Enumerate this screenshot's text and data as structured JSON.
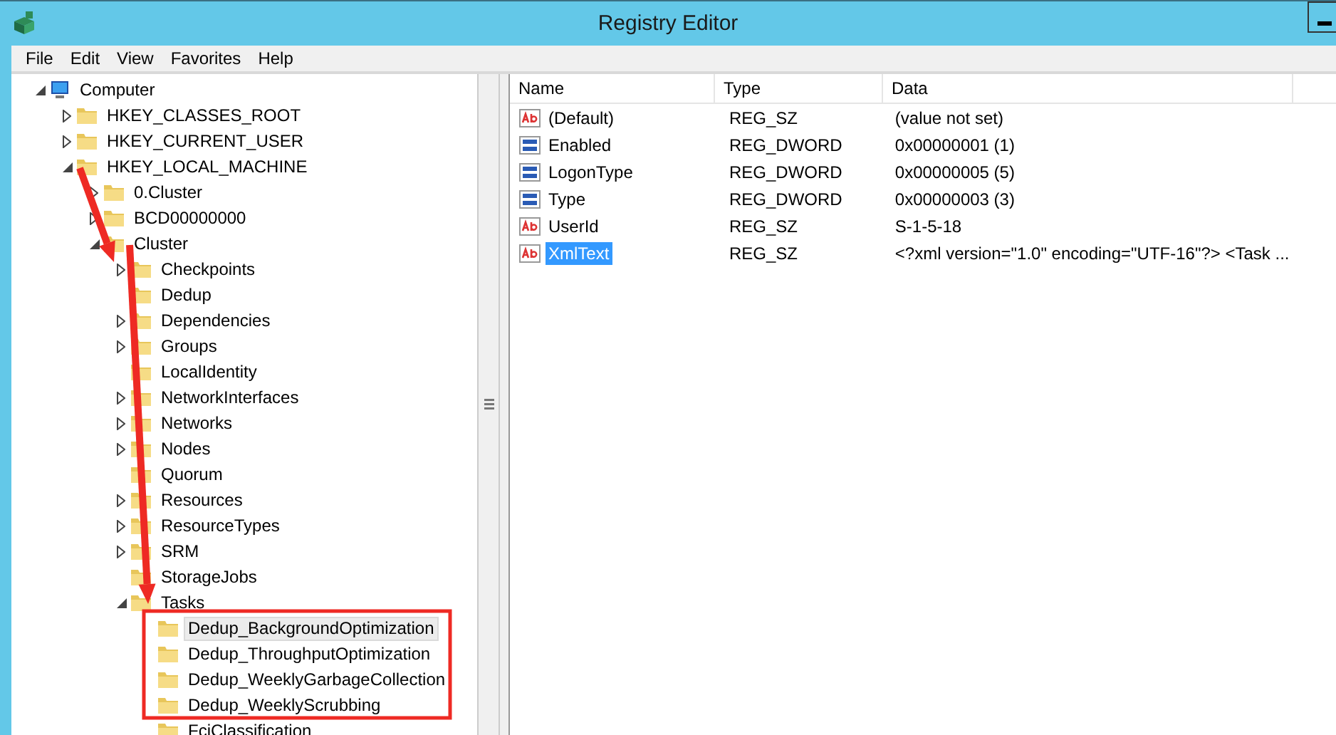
{
  "window": {
    "title": "Registry Editor"
  },
  "menu": [
    "File",
    "Edit",
    "View",
    "Favorites",
    "Help"
  ],
  "tree": [
    {
      "label": "Computer",
      "kind": "computer",
      "expanded": true,
      "selected": false,
      "children": [
        {
          "label": "HKEY_CLASSES_ROOT",
          "kind": "folder",
          "expanded": false,
          "selected": false
        },
        {
          "label": "HKEY_CURRENT_USER",
          "kind": "folder",
          "expanded": false,
          "selected": false
        },
        {
          "label": "HKEY_LOCAL_MACHINE",
          "kind": "folder",
          "expanded": true,
          "selected": false,
          "children": [
            {
              "label": "0.Cluster",
              "kind": "folder",
              "expanded": false,
              "selected": false
            },
            {
              "label": "BCD00000000",
              "kind": "folder",
              "expanded": false,
              "selected": false
            },
            {
              "label": "Cluster",
              "kind": "folder",
              "expanded": true,
              "selected": false,
              "children": [
                {
                  "label": "Checkpoints",
                  "kind": "folder",
                  "expanded": false,
                  "selected": false
                },
                {
                  "label": "Dedup",
                  "kind": "folder",
                  "selected": false
                },
                {
                  "label": "Dependencies",
                  "kind": "folder",
                  "expanded": false,
                  "selected": false
                },
                {
                  "label": "Groups",
                  "kind": "folder",
                  "expanded": false,
                  "selected": false
                },
                {
                  "label": "LocalIdentity",
                  "kind": "folder",
                  "selected": false
                },
                {
                  "label": "NetworkInterfaces",
                  "kind": "folder",
                  "expanded": false,
                  "selected": false
                },
                {
                  "label": "Networks",
                  "kind": "folder",
                  "expanded": false,
                  "selected": false
                },
                {
                  "label": "Nodes",
                  "kind": "folder",
                  "expanded": false,
                  "selected": false
                },
                {
                  "label": "Quorum",
                  "kind": "folder",
                  "selected": false
                },
                {
                  "label": "Resources",
                  "kind": "folder",
                  "expanded": false,
                  "selected": false
                },
                {
                  "label": "ResourceTypes",
                  "kind": "folder",
                  "expanded": false,
                  "selected": false
                },
                {
                  "label": "SRM",
                  "kind": "folder",
                  "expanded": false,
                  "selected": false
                },
                {
                  "label": "StorageJobs",
                  "kind": "folder",
                  "selected": false
                },
                {
                  "label": "Tasks",
                  "kind": "folder",
                  "expanded": true,
                  "selected": false,
                  "children": [
                    {
                      "label": "Dedup_BackgroundOptimization",
                      "kind": "folder",
                      "selected": true
                    },
                    {
                      "label": "Dedup_ThroughputOptimization",
                      "kind": "folder",
                      "selected": false
                    },
                    {
                      "label": "Dedup_WeeklyGarbageCollection",
                      "kind": "folder",
                      "selected": false
                    },
                    {
                      "label": "Dedup_WeeklyScrubbing",
                      "kind": "folder",
                      "selected": false
                    },
                    {
                      "label": "FciClassification",
                      "kind": "folder",
                      "selected": false
                    }
                  ]
                }
              ]
            }
          ]
        }
      ]
    }
  ],
  "values": {
    "columns": [
      "Name",
      "Type",
      "Data"
    ],
    "rows": [
      {
        "name": "(Default)",
        "kind": "string",
        "type": "REG_SZ",
        "data": "(value not set)",
        "selected": false
      },
      {
        "name": "Enabled",
        "kind": "dword",
        "type": "REG_DWORD",
        "data": "0x00000001 (1)",
        "selected": false
      },
      {
        "name": "LogonType",
        "kind": "dword",
        "type": "REG_DWORD",
        "data": "0x00000005 (5)",
        "selected": false
      },
      {
        "name": "Type",
        "kind": "dword",
        "type": "REG_DWORD",
        "data": "0x00000003 (3)",
        "selected": false
      },
      {
        "name": "UserId",
        "kind": "string",
        "type": "REG_SZ",
        "data": "S-1-5-18",
        "selected": false
      },
      {
        "name": "XmlText",
        "kind": "string",
        "type": "REG_SZ",
        "data": "<?xml version=\"1.0\" encoding=\"UTF-16\"?> <Task ...",
        "selected": true
      }
    ]
  }
}
